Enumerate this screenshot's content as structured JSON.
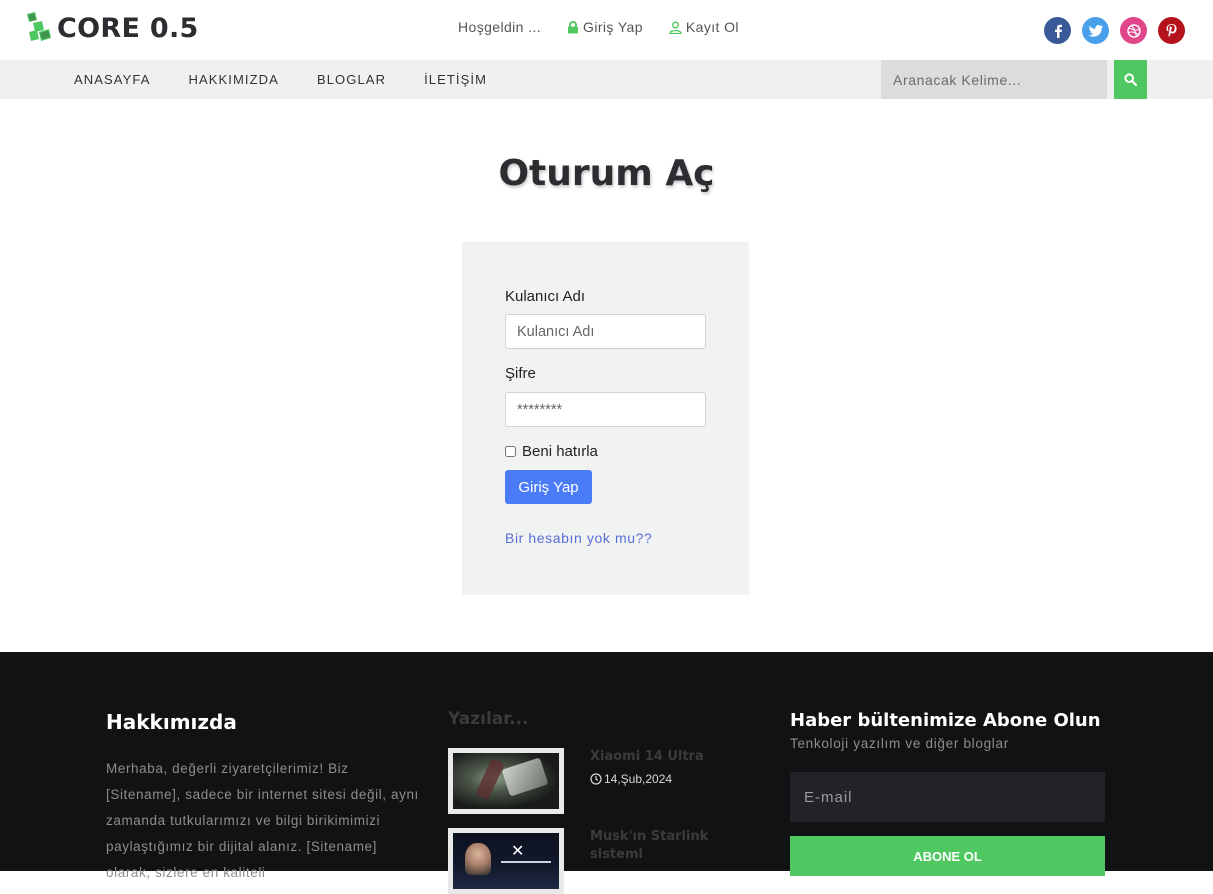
{
  "brand": {
    "name": "CORE 0.5",
    "accent": "#4fc861"
  },
  "top_links": {
    "welcome": "Hoşgeldin ...",
    "login": "Giriş Yap",
    "register": "Kayıt Ol"
  },
  "socials": [
    {
      "name": "facebook",
      "glyph": "f",
      "color": "#3b5998"
    },
    {
      "name": "twitter",
      "glyph": "t",
      "color": "#4a9fea"
    },
    {
      "name": "dribbble",
      "glyph": "d",
      "color": "#e0468a"
    },
    {
      "name": "pinterest",
      "glyph": "p",
      "color": "#b5121b"
    }
  ],
  "nav": {
    "items": [
      "ANASAYFA",
      "HAKKIMIZDA",
      "BLOGLAR",
      "İLETİŞİM"
    ],
    "search_placeholder": "Aranacak Kelime..."
  },
  "login": {
    "title": "Oturum Aç",
    "username_label": "Kulanıcı Adı",
    "username_placeholder": "Kulanıcı Adı",
    "password_label": "Şifre",
    "password_placeholder": "********",
    "remember_label": "Beni hatırla",
    "submit_label": "Giriş Yap",
    "no_account_link": "Bir hesabın yok mu??",
    "submit_color": "#4a7cf7"
  },
  "footer": {
    "about": {
      "title": "Hakkımızda",
      "text": "Merhaba, değerli ziyaretçilerimiz! Biz [Sitename], sadece bir internet sitesi değil, aynı zamanda tutkularımızı ve bilgi birikimimizi paylaştığımız bir dijital alanız. [Sitename] olarak, sizlere en kaliteli"
    },
    "posts": {
      "title": "Yazılar...",
      "items": [
        {
          "title": "Xiaomi 14 Ultra",
          "date": "14,Şub,2024"
        },
        {
          "title": "Musk'ın Starlink sistemi",
          "date": ""
        }
      ]
    },
    "newsletter": {
      "title": "Haber bültenimize Abone Olun",
      "subtitle": "Tenkoloji yazılım ve diğer bloglar",
      "email_placeholder": "E-mail",
      "button_label": "ABONE OL"
    }
  }
}
